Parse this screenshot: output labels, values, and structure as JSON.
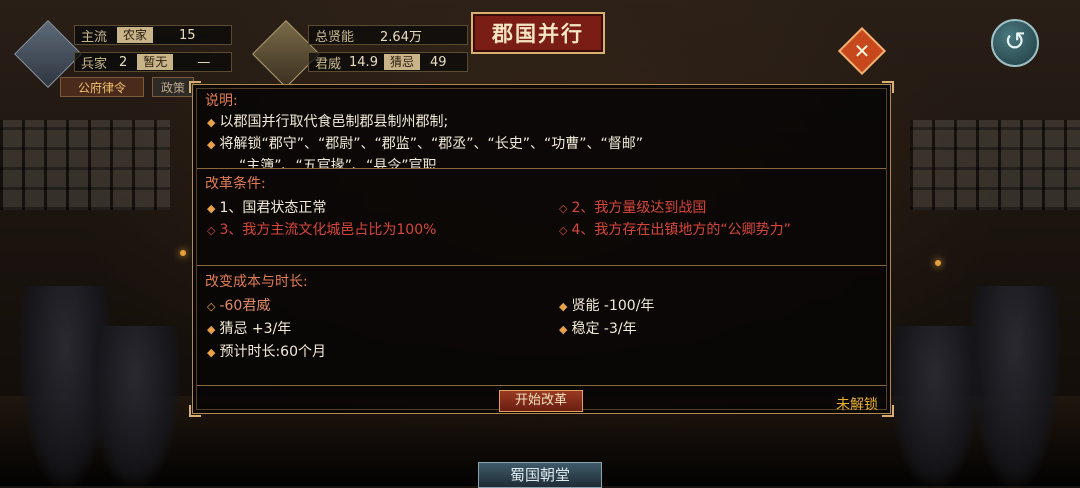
{
  "hud": {
    "mainstream_key": "主流",
    "mainstream_tag": "农家",
    "mainstream_value": "15",
    "military_key": "兵家",
    "military_value": "2",
    "temp_tag": "暂无",
    "temp_value": "—",
    "total_talent_key": "总贤能",
    "total_talent_value": "2.64万",
    "majesty_key": "君威",
    "majesty_value": "14.9",
    "suspicion_key": "猜忌",
    "suspicion_value": "49",
    "tab_active": "公府律令",
    "tab_inactive": "政策"
  },
  "title": "郡国并行",
  "close_label": "✕",
  "back_label": "↺",
  "explanation": {
    "heading": "说明:",
    "lines": [
      "以郡国并行取代食邑制郡县制州郡制;",
      "将解锁“郡守”、“郡尉”、“郡监”、“郡丞”、“长史”、“功曹”、“督邮”",
      "“主簿”、“五官掾”、“县令”官职"
    ]
  },
  "conditions": {
    "heading": "改革条件:",
    "items": [
      {
        "text": "1、国君状态正常",
        "state": "met"
      },
      {
        "text": "2、我方量级达到战国",
        "state": "unmet"
      },
      {
        "text": "3、我方主流文化城邑占比为100%",
        "state": "unmet"
      },
      {
        "text": "4、我方存在出镇地方的“公卿势力”",
        "state": "unmet"
      }
    ]
  },
  "cost": {
    "heading": "改变成本与时长:",
    "items": [
      {
        "text": "-60君威",
        "state": "unmet"
      },
      {
        "text": "贤能 -100/年",
        "state": "met"
      },
      {
        "text": "猜忌 +3/年",
        "state": "met"
      },
      {
        "text": "稳定 -3/年",
        "state": "met"
      },
      {
        "text": "预计时长:60个月",
        "state": "met"
      }
    ]
  },
  "start_button": "开始改革",
  "locked_status": "未解锁",
  "bottom_tab": "蜀国朝堂"
}
